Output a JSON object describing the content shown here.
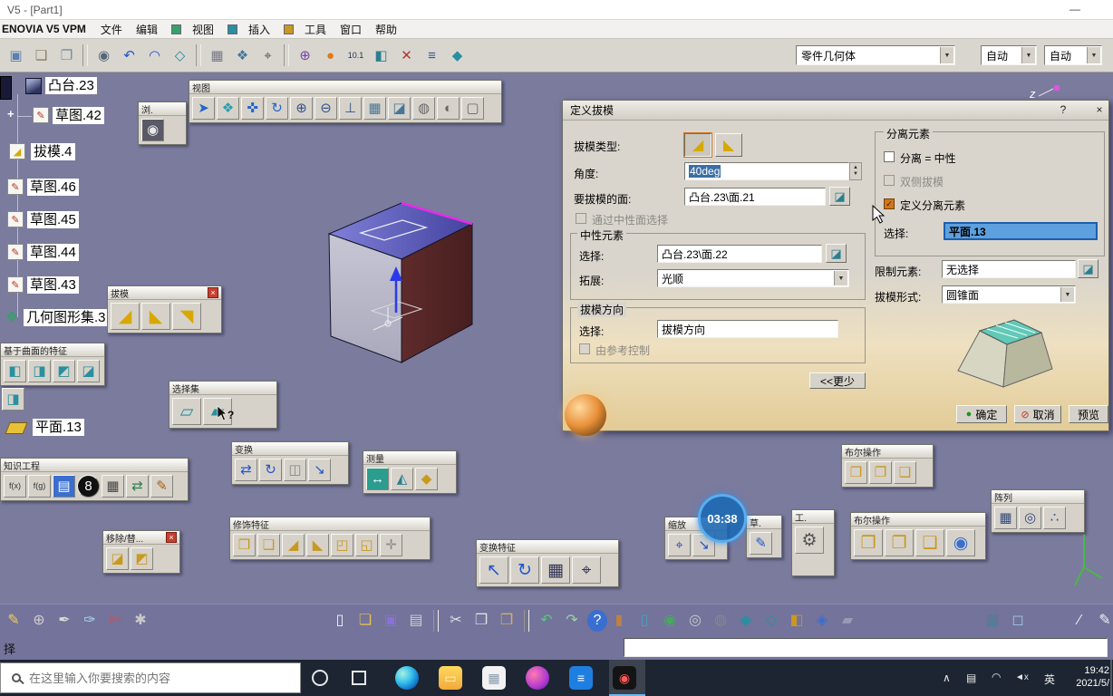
{
  "window": {
    "title": "V5 - [Part1]",
    "minimize": "—"
  },
  "menubar": {
    "brand": "ENOVIA V5 VPM",
    "items": [
      "文件",
      "编辑",
      "视图",
      "插入",
      "工具",
      "窗口",
      "帮助"
    ]
  },
  "topbar": {
    "geo_combo": "零件几何体",
    "auto_combo_1": "自动",
    "auto_combo_2": "自动",
    "icons": [
      {
        "n": "workbench-icon",
        "g": "▣",
        "c": "#5b7fae"
      },
      {
        "n": "paste-format-icon",
        "g": "❏",
        "c": "#8a7a5a"
      },
      {
        "n": "copy-link-icon",
        "g": "❐",
        "c": "#7a8a9a"
      },
      {
        "sep": true
      },
      {
        "n": "camera-capture-icon",
        "g": "◉",
        "c": "#556677"
      },
      {
        "n": "undo-curve-icon",
        "g": "↶",
        "c": "#2255cc"
      },
      {
        "n": "arc-icon",
        "g": "◠",
        "c": "#2255cc"
      },
      {
        "n": "surface-icon",
        "g": "◇",
        "c": "#22889a"
      },
      {
        "sep": true
      },
      {
        "n": "catalog-icon",
        "g": "▦",
        "c": "#777788"
      },
      {
        "n": "graph-tree-icon",
        "g": "❖",
        "c": "#447799"
      },
      {
        "n": "measure-icon",
        "g": "⌖",
        "c": "#555555"
      },
      {
        "sep": true
      },
      {
        "n": "compass-icon",
        "g": "⊕",
        "c": "#7744aa"
      },
      {
        "n": "select-hand-icon",
        "g": "●",
        "c": "#e07818"
      },
      {
        "n": "coordinates-icon",
        "g": "10.1",
        "c": "#223355",
        "fs": 9
      },
      {
        "n": "datum-icon",
        "g": "◧",
        "c": "#2a7f8f"
      },
      {
        "n": "constraint-icon",
        "g": "✕",
        "c": "#bb3333"
      },
      {
        "n": "list-icon",
        "g": "≡",
        "c": "#335599"
      },
      {
        "n": "part-body-icon",
        "g": "◆",
        "c": "#2a8f9f"
      }
    ]
  },
  "tree": {
    "items": [
      {
        "label": "凸台.23"
      },
      {
        "label": "草图.42"
      },
      {
        "label": "拔模.4"
      },
      {
        "label": "草图.46"
      },
      {
        "label": "草图.45"
      },
      {
        "label": "草图.44"
      },
      {
        "label": "草图.43"
      },
      {
        "label": "几何图形集.3"
      },
      {
        "label": "平面.13"
      }
    ]
  },
  "floats": {
    "browse": {
      "title": "浏.",
      "icons": [
        {
          "n": "camera-icon",
          "g": "◉",
          "c": "#e8e8e8",
          "b": "#5a5a66"
        }
      ]
    },
    "view": {
      "title": "视图",
      "icons": [
        {
          "n": "fly-icon",
          "g": "➤",
          "c": "#2266cc"
        },
        {
          "n": "fit-all-icon",
          "g": "❖",
          "c": "#22a0b0"
        },
        {
          "n": "pan-icon",
          "g": "✜",
          "c": "#2266cc"
        },
        {
          "n": "rotate-icon",
          "g": "↻",
          "c": "#2266cc"
        },
        {
          "n": "zoom-in-icon",
          "g": "⊕",
          "c": "#335588"
        },
        {
          "n": "zoom-out-icon",
          "g": "⊖",
          "c": "#335588"
        },
        {
          "n": "normal-view-icon",
          "g": "⊥",
          "c": "#335588"
        },
        {
          "n": "multi-view-icon",
          "g": "▦",
          "c": "#447799"
        },
        {
          "n": "iso-view-icon",
          "g": "◪",
          "c": "#447799"
        },
        {
          "n": "shading-icon",
          "g": "◍",
          "c": "#666666"
        },
        {
          "n": "hide-show-icon",
          "g": "◐",
          "c": "#666666"
        },
        {
          "n": "full-screen-icon",
          "g": "▢",
          "c": "#666666"
        }
      ]
    },
    "draft": {
      "title": "拔模",
      "icons": [
        {
          "n": "draft-angle-icon",
          "g": "◢",
          "c": "#d8a800"
        },
        {
          "n": "draft-reflect-line-icon",
          "g": "◣",
          "c": "#d8a800"
        },
        {
          "n": "variable-draft-icon",
          "g": "◥",
          "c": "#d8a800"
        }
      ]
    },
    "selsets": {
      "title": "选择集",
      "icons": [
        {
          "n": "selection-set-icon",
          "g": "▱",
          "c": "#2a8f9f"
        },
        {
          "n": "selection-set-edit-icon",
          "g": "▰",
          "c": "#2a8f9f"
        }
      ]
    },
    "surf": {
      "title": "基于曲面的特征",
      "icons": [
        {
          "n": "split-icon",
          "g": "◧",
          "c": "#2a8f9f"
        },
        {
          "n": "thick-surface-icon",
          "g": "◨",
          "c": "#2a8f9f"
        },
        {
          "n": "close-surface-icon",
          "g": "◩",
          "c": "#2a8f9f"
        },
        {
          "n": "sew-surface-icon",
          "g": "◪",
          "c": "#2a8f9f"
        }
      ]
    },
    "knowledge": {
      "title": "知识工程",
      "icons": [
        {
          "n": "formula-icon",
          "g": "f(x)",
          "c": "#333333",
          "fs": 9
        },
        {
          "n": "law-icon",
          "g": "f(g)",
          "c": "#333333",
          "fs": 9
        },
        {
          "n": "rule-book-icon",
          "g": "▤",
          "c": "#ffffff",
          "b": "#3a6ed0"
        },
        {
          "n": "check-ball-icon",
          "g": "8",
          "c": "#ffffff",
          "b": "#111111",
          "round": true
        },
        {
          "n": "design-table-icon",
          "g": "▦",
          "c": "#444444"
        },
        {
          "n": "knowledge-exchange-icon",
          "g": "⇄",
          "c": "#2a7f4f"
        },
        {
          "n": "edit-parameter-icon",
          "g": "✎",
          "c": "#a86010"
        }
      ]
    },
    "removerep": {
      "title": "移除/替...",
      "icons": [
        {
          "n": "remove-face-icon",
          "g": "◪",
          "c": "#c89820"
        },
        {
          "n": "replace-face-icon",
          "g": "◩",
          "c": "#c89820"
        }
      ]
    },
    "transform": {
      "title": "变换",
      "icons": [
        {
          "n": "translate-icon",
          "g": "⇄",
          "c": "#2255cc"
        },
        {
          "n": "rotate-body-icon",
          "g": "↻",
          "c": "#2255cc"
        },
        {
          "n": "symmetry-icon",
          "g": "◫",
          "c": "#888888"
        },
        {
          "n": "scale-body-icon",
          "g": "↘",
          "c": "#2255cc"
        }
      ]
    },
    "measure": {
      "title": "测量",
      "icons": [
        {
          "n": "measure-between-icon",
          "g": "↔",
          "c": "#ffffff",
          "b": "#2a9d8f"
        },
        {
          "n": "measure-item-icon",
          "g": "◭",
          "c": "#2a7f8f"
        },
        {
          "n": "measure-inertia-icon",
          "g": "◆",
          "c": "#c89820"
        }
      ]
    },
    "dressup": {
      "title": "修饰特征",
      "icons": [
        {
          "n": "edge-fillet-icon",
          "g": "❒",
          "c": "#c89820"
        },
        {
          "n": "variable-fillet-icon",
          "g": "❑",
          "c": "#c89820"
        },
        {
          "n": "chamfer-icon",
          "g": "◢",
          "c": "#c89820"
        },
        {
          "n": "draft-feature-icon",
          "g": "◣",
          "c": "#c89820"
        },
        {
          "n": "shell-icon",
          "g": "◰",
          "c": "#c89820"
        },
        {
          "n": "thickness-icon",
          "g": "◱",
          "c": "#c89820"
        },
        {
          "n": "thread-icon",
          "g": "✛",
          "c": "#888888"
        }
      ]
    },
    "tfeat": {
      "title": "变换特征",
      "icons": [
        {
          "n": "translation-icon",
          "g": "↖",
          "c": "#2255cc"
        },
        {
          "n": "rotation-icon",
          "g": "↻",
          "c": "#2255cc"
        },
        {
          "n": "pattern-grid-icon",
          "g": "▦",
          "c": "#333355"
        },
        {
          "n": "scaling-icon",
          "g": "⌖",
          "c": "#333355"
        }
      ]
    },
    "zoom": {
      "title": "缩放",
      "icons": [
        {
          "n": "zoom-area-icon",
          "g": "⌖",
          "c": "#2255cc"
        },
        {
          "n": "zoom-fit-icon",
          "g": "↘",
          "c": "#2255cc"
        }
      ]
    },
    "sketcher": {
      "title": "草.",
      "icons": [
        {
          "n": "sketch-tool-icon",
          "g": "✎",
          "c": "#2255cc"
        }
      ]
    },
    "tools": {
      "title": "工.",
      "icons": [
        {
          "n": "gear-icon",
          "g": "⚙",
          "c": "#555555",
          "fs": 19
        }
      ]
    },
    "bool1": {
      "title": "布尔操作",
      "icons": [
        {
          "n": "assemble-icon",
          "g": "❒",
          "c": "#c89820"
        },
        {
          "n": "boolean-add-icon",
          "g": "❐",
          "c": "#c89820"
        },
        {
          "n": "boolean-remove-icon",
          "g": "❑",
          "c": "#c89820"
        }
      ]
    },
    "bool2": {
      "title": "布尔操作",
      "icons": [
        {
          "n": "union-trim-icon",
          "g": "❒",
          "c": "#c89820"
        },
        {
          "n": "remove-lump-icon",
          "g": "❐",
          "c": "#c89820"
        },
        {
          "n": "intersect-icon",
          "g": "❑",
          "c": "#c89820"
        },
        {
          "n": "assemble-body-icon",
          "g": "◉",
          "c": "#3a6ed0"
        }
      ]
    },
    "pattern": {
      "title": "阵列",
      "icons": [
        {
          "n": "rect-pattern-icon",
          "g": "▦",
          "c": "#334a7a"
        },
        {
          "n": "circ-pattern-icon",
          "g": "◎",
          "c": "#334a7a"
        },
        {
          "n": "user-pattern-icon",
          "g": "∴",
          "c": "#334a7a"
        }
      ]
    }
  },
  "dialog": {
    "title": "定义拔模",
    "draft_type_label": "拔模类型:",
    "angle_label": "角度:",
    "angle_value": "40deg",
    "faces_label": "要拔模的面:",
    "faces_value": "凸台.23\\面.21",
    "by_neutral_checkbox": "通过中性面选择",
    "neutral_group": {
      "title": "中性元素",
      "select_label": "选择:",
      "select_value": "凸台.23\\面.22",
      "propagation_label": "拓展:",
      "propagation_value": "光顺"
    },
    "direction_group": {
      "title": "拔模方向",
      "select_label": "选择:",
      "select_value": "拔模方向",
      "controlled_checkbox": "由参考控制"
    },
    "less_button": "<<更少",
    "parting_group": {
      "title": "分离元素",
      "parting_neutral_checkbox": "分离 = 中性",
      "both_sides_checkbox": "双侧拔模",
      "define_parting_checkbox": "定义分离元素",
      "select_label": "选择:",
      "select_value": "平面.13"
    },
    "limiting_label": "限制元素:",
    "limiting_value": "无选择",
    "form_label": "拔模形式:",
    "form_value": "圆锥面",
    "ok_button": "确定",
    "cancel_button": "取消",
    "preview_button": "预览"
  },
  "overlay": {
    "time": "03:38"
  },
  "dock": {
    "status_text": "择",
    "left_icons": [
      {
        "n": "pencil-tool-icon",
        "g": "✎",
        "c": "#f0d060"
      },
      {
        "n": "compass-tool-icon",
        "g": "⊕",
        "c": "#cccccc"
      },
      {
        "n": "pen-tool-icon",
        "g": "✒",
        "c": "#d8d8d8"
      },
      {
        "n": "brush-tool-icon",
        "g": "✑",
        "c": "#a8d8e8"
      },
      {
        "n": "knife-tool-icon",
        "g": "✄",
        "c": "#d05050"
      },
      {
        "n": "web-analysis-icon",
        "g": "✱",
        "c": "#c8c8c8"
      }
    ],
    "std_icons": [
      {
        "n": "new-doc-icon",
        "g": "▯",
        "c": "#f5f5f5"
      },
      {
        "n": "open-icon",
        "g": "❏",
        "c": "#e8c050"
      },
      {
        "n": "save-icon",
        "g": "▣",
        "c": "#8a70d8"
      },
      {
        "n": "print-icon",
        "g": "▤",
        "c": "#cfcfcf"
      },
      {
        "sep": true
      },
      {
        "n": "cut-icon",
        "g": "✂",
        "c": "#e0e0e0"
      },
      {
        "n": "copy-icon",
        "g": "❐",
        "c": "#e0e0e0"
      },
      {
        "n": "paste-icon",
        "g": "❒",
        "c": "#d8b060"
      },
      {
        "sep": true
      },
      {
        "n": "undo-icon",
        "g": "↶",
        "c": "#58c878"
      },
      {
        "n": "redo-icon",
        "g": "↷",
        "c": "#9ad0a8"
      },
      {
        "n": "help-icon",
        "g": "?",
        "c": "#ffffff",
        "b": "#3a6ed0",
        "round": true
      }
    ],
    "feature_icons": [
      {
        "n": "pad-icon",
        "g": "▮",
        "c": "#c08040"
      },
      {
        "n": "pocket-icon",
        "g": "▯",
        "c": "#4aa0c0"
      },
      {
        "n": "shaft-icon",
        "g": "◉",
        "c": "#48a860"
      },
      {
        "n": "groove-icon",
        "g": "◎",
        "c": "#c8c8c8"
      },
      {
        "n": "hole-icon",
        "g": "◍",
        "c": "#888888"
      },
      {
        "n": "rib-icon",
        "g": "◆",
        "c": "#2a8f9f"
      },
      {
        "n": "slot-icon",
        "g": "◇",
        "c": "#2a8f9f"
      },
      {
        "n": "stiffener-icon",
        "g": "◧",
        "c": "#c89820"
      },
      {
        "n": "loft-icon",
        "g": "◈",
        "c": "#3a6ed0"
      },
      {
        "n": "thick-icon",
        "g": "▰",
        "c": "#9a9ab8"
      }
    ],
    "right_icons": [
      {
        "n": "grid-icon",
        "g": "▦",
        "c": "#2a8f9f"
      },
      {
        "n": "snap-icon",
        "g": "◻",
        "c": "#9ac8e8"
      }
    ],
    "draw_icons": [
      {
        "n": "line-tool-icon",
        "g": "∕",
        "c": "#f0f0f0"
      },
      {
        "n": "curve-tool-icon",
        "g": "✎",
        "c": "#f0f0f0"
      }
    ]
  },
  "taskbar": {
    "search_placeholder": "在这里输入你要搜索的内容",
    "apps": [
      {
        "n": "taskbar-app-edge",
        "b": "radial-gradient(circle at 32% 32%, #a8f0e0, #35c1ec 40%, #0c64c0 78%)",
        "round": true
      },
      {
        "n": "taskbar-app-file-explorer",
        "g": "▭",
        "c": "#fff8d0",
        "b": "linear-gradient(180deg,#ffd95e,#f2a93b)"
      },
      {
        "n": "taskbar-app-photos",
        "g": "▦",
        "c": "#8899aa",
        "b": "#f2f2f2"
      },
      {
        "n": "taskbar-app-media",
        "b": "radial-gradient(circle at 35% 35%, #ff7ab0, #b03ad0 60%, #5a1a90)",
        "round": true
      },
      {
        "n": "taskbar-app-docs",
        "g": "≡",
        "c": "#ffffff",
        "b": "#1e7fe0"
      },
      {
        "n": "taskbar-app-player",
        "g": "◉",
        "c": "#ff5a5a",
        "b": "#141414"
      }
    ],
    "caret": "∧",
    "tray_icon": "▤",
    "wifi": "◠",
    "volume": "◄x",
    "lang": "英",
    "time": "19:42",
    "date": "2021/5/"
  },
  "glyphs": {
    "close": "×",
    "help": "?",
    "dropdown": "▼",
    "spin_up": "▲",
    "spin_down": "▼",
    "pick": "◪",
    "ok_bullet": "●",
    "cancel_bullet": "⊘",
    "check": "✓",
    "plus": "+",
    "sketch_pencil": "✎",
    "draft_corner": "◢",
    "draft_corner2": "◣",
    "geoset_star": "❖",
    "z_label": "z"
  }
}
